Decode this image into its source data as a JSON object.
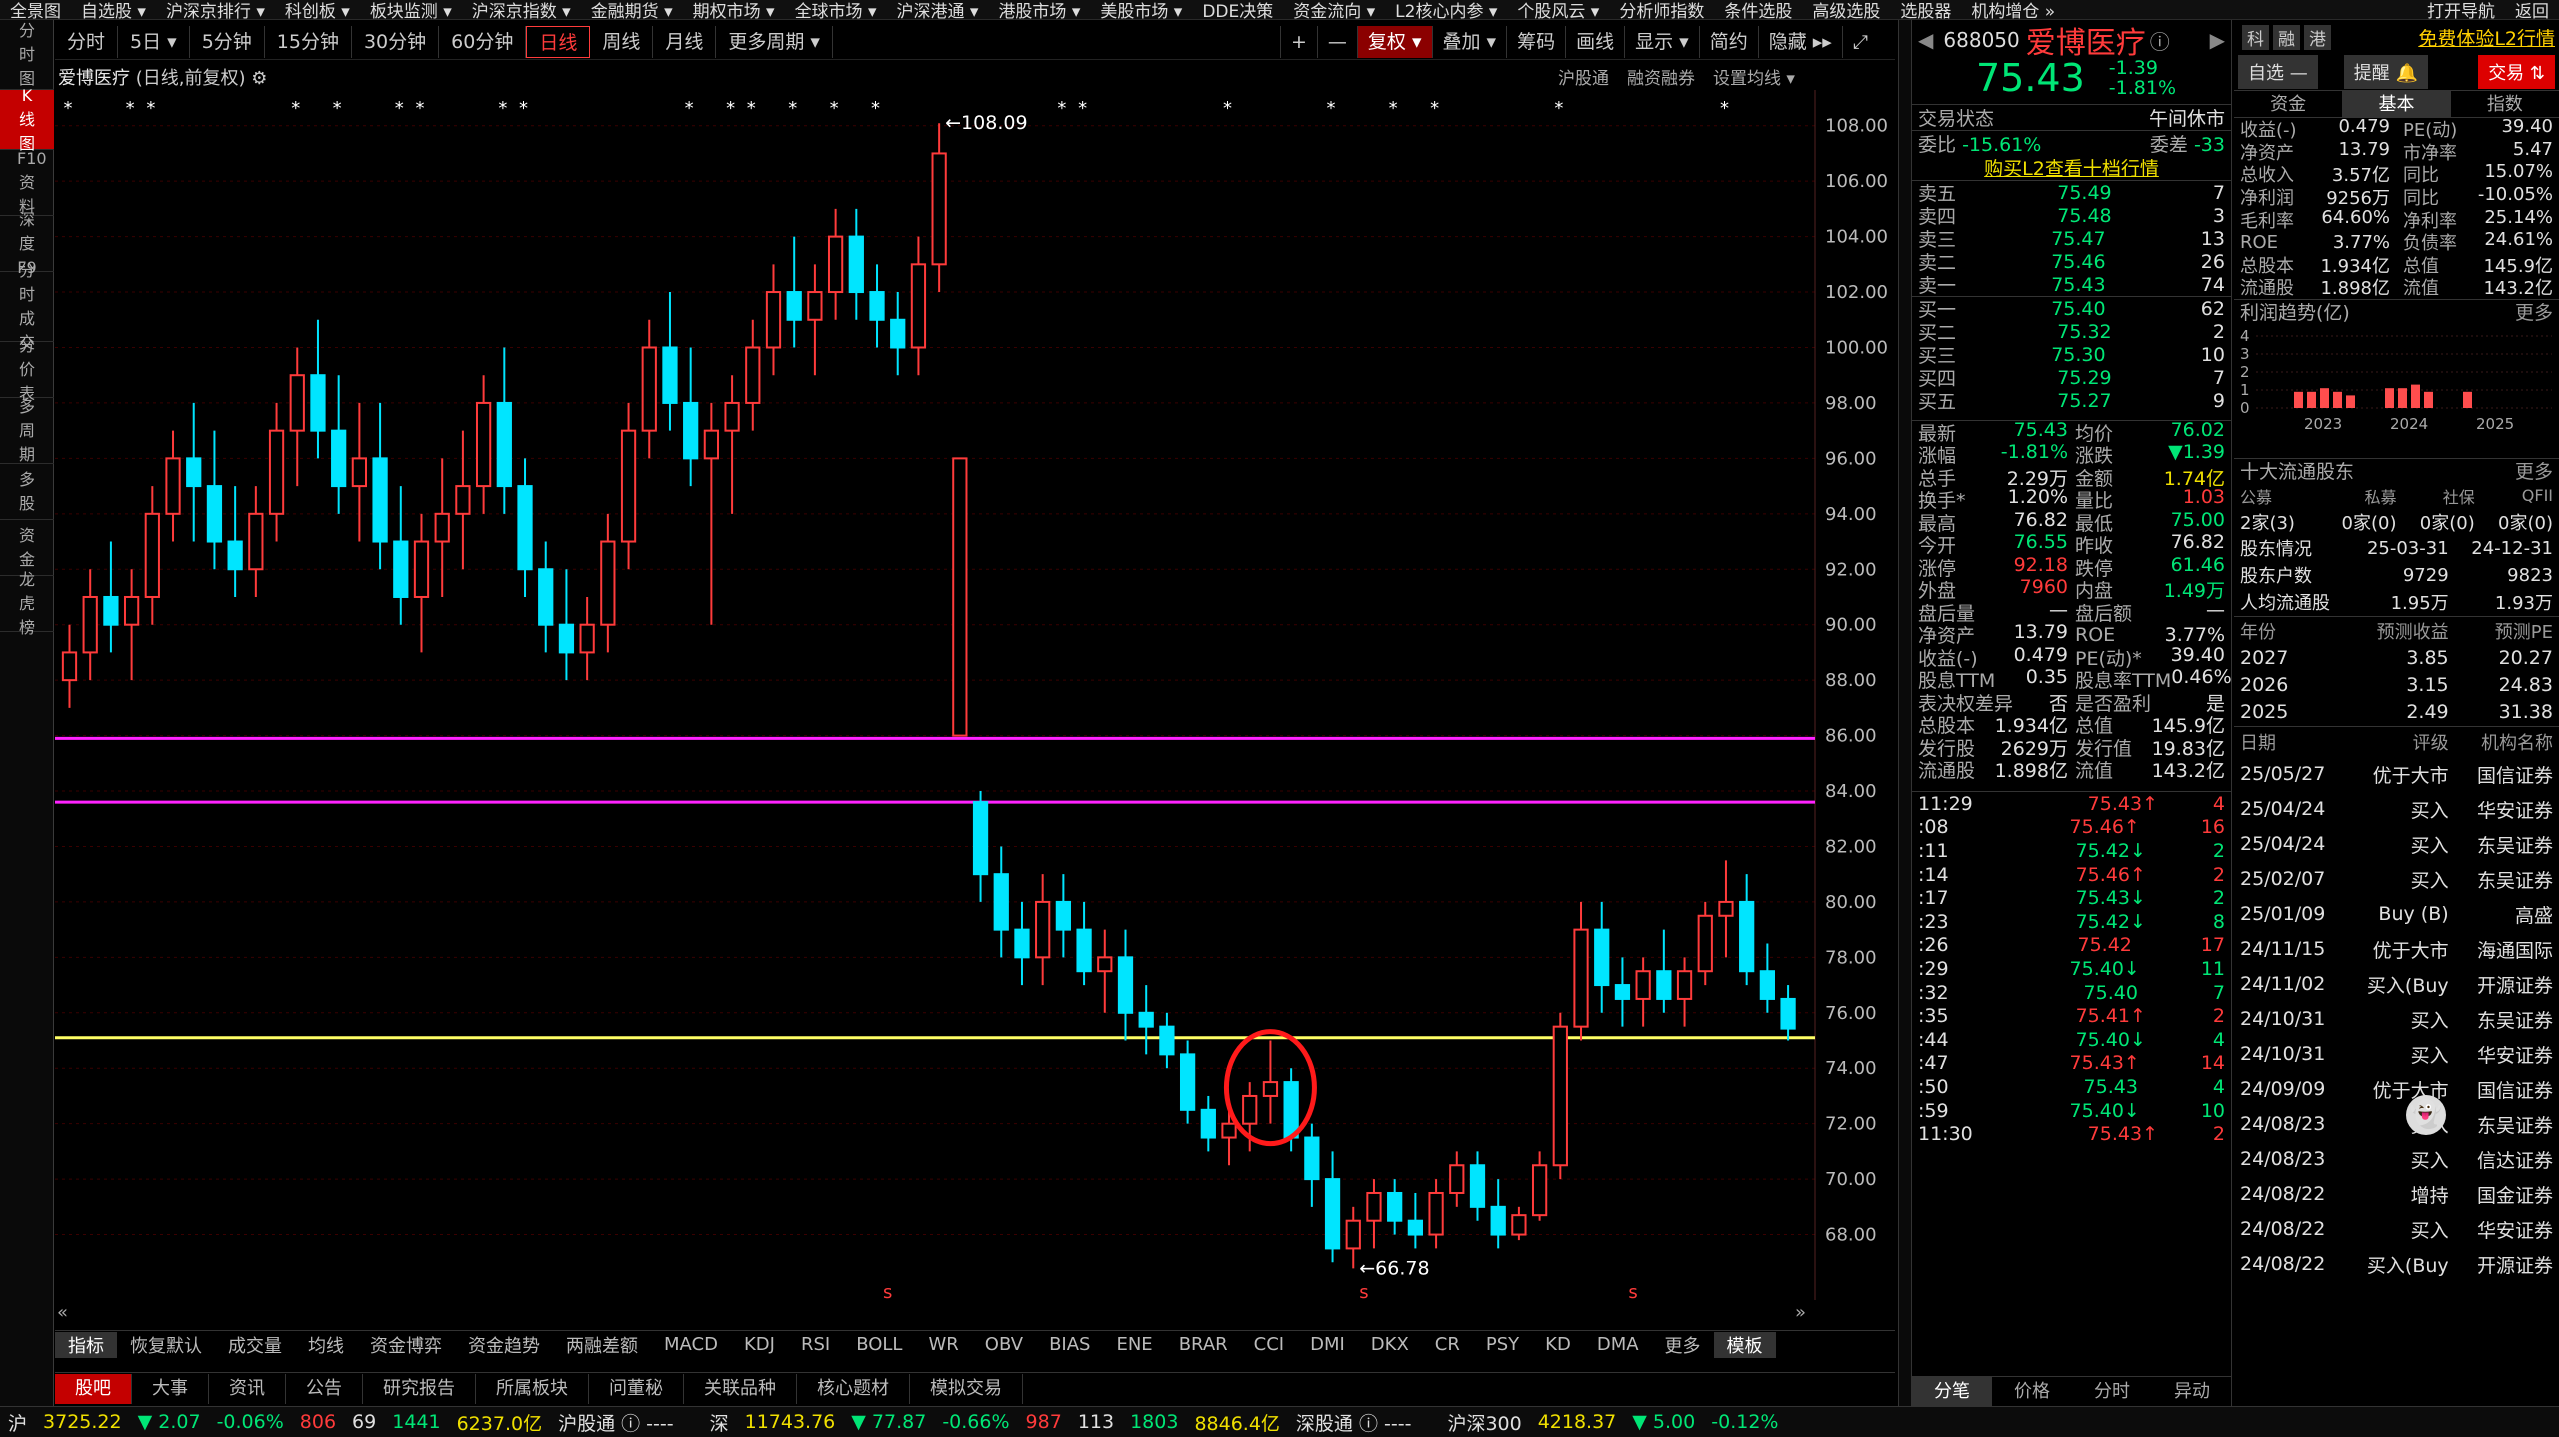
{
  "menu": [
    "全景图",
    "自选股 ▾",
    "沪深京排行 ▾",
    "科创板 ▾",
    "板块监测 ▾",
    "沪深京指数 ▾",
    "金融期货 ▾",
    "期权市场 ▾",
    "全球市场 ▾",
    "沪深港通 ▾",
    "港股市场 ▾",
    "美股市场 ▾",
    "DDE决策",
    "资金流向 ▾",
    "L2核心内参 ▾",
    "个股风云 ▾",
    "分析师指数",
    "条件选股",
    "高级选股",
    "选股器",
    "机构增仓 »"
  ],
  "menu_right": [
    "打开导航",
    "返回"
  ],
  "leftnav": [
    {
      "t": "分时图",
      "a": false
    },
    {
      "t": "K线图",
      "a": true
    },
    {
      "t": "F10资料",
      "a": false
    },
    {
      "t": "深度F9",
      "a": false
    },
    {
      "t": "分时成交",
      "a": false
    },
    {
      "t": "分价表",
      "a": false
    },
    {
      "t": "多周期",
      "a": false
    },
    {
      "t": "多股",
      "a": false
    },
    {
      "t": "资金",
      "a": false
    },
    {
      "t": "龙虎榜",
      "a": false
    }
  ],
  "periods": [
    {
      "t": "分时",
      "a": false
    },
    {
      "t": "5日 ▾",
      "a": false
    },
    {
      "t": "5分钟",
      "a": false
    },
    {
      "t": "15分钟",
      "a": false
    },
    {
      "t": "30分钟",
      "a": false
    },
    {
      "t": "60分钟",
      "a": false
    },
    {
      "t": "日线",
      "a": true
    },
    {
      "t": "周线",
      "a": false
    },
    {
      "t": "月线",
      "a": false
    },
    {
      "t": "更多周期 ▾",
      "a": false
    }
  ],
  "tools": [
    {
      "t": "+",
      "c": ""
    },
    {
      "t": "—",
      "c": ""
    },
    {
      "t": "复权 ▾",
      "c": "red"
    },
    {
      "t": "叠加 ▾",
      "c": ""
    },
    {
      "t": "筹码",
      "c": ""
    },
    {
      "t": "画线",
      "c": ""
    },
    {
      "t": "显示 ▾",
      "c": ""
    },
    {
      "t": "简约",
      "c": ""
    },
    {
      "t": "隐藏 ▸▸",
      "c": ""
    },
    {
      "t": "⤢",
      "c": ""
    }
  ],
  "chart_header": {
    "name": "爱博医疗",
    "mode": "(日线,前复权)"
  },
  "chart_links": [
    "沪股通",
    "融资融券",
    "设置均线 ▾"
  ],
  "indicator_tabs": [
    "指标",
    "恢复默认",
    "成交量",
    "均线",
    "资金博弈",
    "资金趋势",
    "两融差额",
    "MACD",
    "KDJ",
    "RSI",
    "BOLL",
    "WR",
    "OBV",
    "BIAS",
    "ENE",
    "BRAR",
    "CCI",
    "DMI",
    "DKX",
    "CR",
    "PSY",
    "KD",
    "DMA",
    "更多",
    "模板"
  ],
  "main_tabs": [
    "股吧",
    "大事",
    "资讯",
    "公告",
    "研究报告",
    "所属板块",
    "问董秘",
    "关联品种",
    "核心题材",
    "模拟交易"
  ],
  "status": {
    "sh": "沪",
    "sh_val": "3725.22",
    "sh_chg": "▼ 2.07",
    "sh_pct": "-0.06%",
    "sh_up": "806",
    "sh_flat": "69",
    "sh_dn": "1441",
    "sh_amt": "6237.0亿",
    "hgt": "沪股通 ⓘ ----",
    "sz": "深",
    "sz_val": "11743.76",
    "sz_chg": "▼ 77.87",
    "sz_pct": "-0.66%",
    "sz_up": "987",
    "sz_flat": "113",
    "sz_dn": "1803",
    "sz_amt": "8846.4亿",
    "sgt": "深股通 ⓘ ----",
    "hs300": "沪深300",
    "hs300_val": "4218.37",
    "hs300_chg": "▼ 5.00",
    "hs300_pct": "-0.12%"
  },
  "quote": {
    "code": "688050",
    "name": "爱博医疗",
    "price": "75.43",
    "chg": "-1.39",
    "pct": "-1.81%",
    "tags": [
      "科",
      "融",
      "港"
    ],
    "promo": "免费体验L2行情",
    "btn_watch": "自选 —",
    "btn_alert": "提醒 🔔",
    "btn_trade": "交易 ⇅",
    "trade_status_label": "交易状态",
    "trade_status": "午间休市",
    "weibi_label": "委比",
    "weibi": "-15.61%",
    "weicha_label": "委差",
    "weicha": "-33",
    "l2": "购买L2查看十档行情"
  },
  "asks": [
    {
      "l": "卖五",
      "p": "75.49",
      "v": "7"
    },
    {
      "l": "卖四",
      "p": "75.48",
      "v": "3"
    },
    {
      "l": "卖三",
      "p": "75.47",
      "v": "13"
    },
    {
      "l": "卖二",
      "p": "75.46",
      "v": "26"
    },
    {
      "l": "卖一",
      "p": "75.43",
      "v": "74"
    }
  ],
  "bids": [
    {
      "l": "买一",
      "p": "75.40",
      "v": "62"
    },
    {
      "l": "买二",
      "p": "75.32",
      "v": "2"
    },
    {
      "l": "买三",
      "p": "75.30",
      "v": "10"
    },
    {
      "l": "买四",
      "p": "75.29",
      "v": "7"
    },
    {
      "l": "买五",
      "p": "75.27",
      "v": "9"
    }
  ],
  "stats": [
    {
      "l1": "最新",
      "v1": "75.43",
      "c1": "g",
      "l2": "均价",
      "v2": "76.02",
      "c2": "g"
    },
    {
      "l1": "涨幅",
      "v1": "-1.81%",
      "c1": "g",
      "l2": "涨跌",
      "v2": "▼1.39",
      "c2": "g"
    },
    {
      "l1": "总手",
      "v1": "2.29万",
      "c1": "w",
      "l2": "金额",
      "v2": "1.74亿",
      "c2": "y"
    },
    {
      "l1": "换手*",
      "v1": "1.20%",
      "c1": "w",
      "l2": "量比",
      "v2": "1.03",
      "c2": "r"
    },
    {
      "l1": "最高",
      "v1": "76.82",
      "c1": "w",
      "l2": "最低",
      "v2": "75.00",
      "c2": "g"
    },
    {
      "l1": "今开",
      "v1": "76.55",
      "c1": "g",
      "l2": "昨收",
      "v2": "76.82",
      "c2": "w"
    },
    {
      "l1": "涨停",
      "v1": "92.18",
      "c1": "r",
      "l2": "跌停",
      "v2": "61.46",
      "c2": "g"
    },
    {
      "l1": "外盘",
      "v1": "7960",
      "c1": "r",
      "l2": "内盘",
      "v2": "1.49万",
      "c2": "g"
    },
    {
      "l1": "盘后量",
      "v1": "—",
      "c1": "w",
      "l2": "盘后额",
      "v2": "—",
      "c2": "w"
    },
    {
      "l1": "净资产",
      "v1": "13.79",
      "c1": "w",
      "l2": "ROE",
      "v2": "3.77%",
      "c2": "w"
    },
    {
      "l1": "收益(-)",
      "v1": "0.479",
      "c1": "w",
      "l2": "PE(动)*",
      "v2": "39.40",
      "c2": "w"
    },
    {
      "l1": "股息TTM",
      "v1": "0.35",
      "c1": "w",
      "l2": "股息率TTM",
      "v2": "0.46%",
      "c2": "w"
    },
    {
      "l1": "表决权差异",
      "v1": "否",
      "c1": "w",
      "l2": "是否盈利",
      "v2": "是",
      "c2": "w"
    },
    {
      "l1": "总股本",
      "v1": "1.934亿",
      "c1": "w",
      "l2": "总值",
      "v2": "145.9亿",
      "c2": "w"
    },
    {
      "l1": "发行股",
      "v1": "2629万",
      "c1": "w",
      "l2": "发行值",
      "v2": "19.83亿",
      "c2": "w"
    },
    {
      "l1": "流通股",
      "v1": "1.898亿",
      "c1": "w",
      "l2": "流值",
      "v2": "143.2亿",
      "c2": "w"
    }
  ],
  "ticks": [
    {
      "t": "11:29",
      "p": "75.43",
      "d": "↑",
      "v": "4",
      "c": "r"
    },
    {
      "t": ":08",
      "p": "75.46",
      "d": "↑",
      "v": "16",
      "c": "r"
    },
    {
      "t": ":11",
      "p": "75.42",
      "d": "↓",
      "v": "2",
      "c": "g"
    },
    {
      "t": ":14",
      "p": "75.46",
      "d": "↑",
      "v": "2",
      "c": "r"
    },
    {
      "t": ":17",
      "p": "75.43",
      "d": "↓",
      "v": "2",
      "c": "g"
    },
    {
      "t": ":23",
      "p": "75.42",
      "d": "↓",
      "v": "8",
      "c": "g"
    },
    {
      "t": ":26",
      "p": "75.42",
      "d": "",
      "v": "17",
      "c": "r"
    },
    {
      "t": ":29",
      "p": "75.40",
      "d": "↓",
      "v": "11",
      "c": "g"
    },
    {
      "t": ":32",
      "p": "75.40",
      "d": "",
      "v": "7",
      "c": "g"
    },
    {
      "t": ":35",
      "p": "75.41",
      "d": "↑",
      "v": "2",
      "c": "r"
    },
    {
      "t": ":44",
      "p": "75.40",
      "d": "↓",
      "v": "4",
      "c": "g"
    },
    {
      "t": ":47",
      "p": "75.43",
      "d": "↑",
      "v": "14",
      "c": "r"
    },
    {
      "t": ":50",
      "p": "75.43",
      "d": "",
      "v": "4",
      "c": "g"
    },
    {
      "t": ":59",
      "p": "75.40",
      "d": "↓",
      "v": "10",
      "c": "g"
    },
    {
      "t": "11:30",
      "p": "75.43",
      "d": "↑",
      "v": "2",
      "c": "r"
    }
  ],
  "rp_tabs": [
    "分笔",
    "价格",
    "分时",
    "异动"
  ],
  "fin_tabs": [
    "资金",
    "基本",
    "指数"
  ],
  "fin": [
    {
      "l1": "收益(-)",
      "v1": "0.479",
      "l2": "PE(动)",
      "v2": "39.40"
    },
    {
      "l1": "净资产",
      "v1": "13.79",
      "l2": "市净率",
      "v2": "5.47"
    },
    {
      "l1": "总收入",
      "v1": "3.57亿",
      "l2": "同比",
      "v2": "15.07%"
    },
    {
      "l1": "净利润",
      "v1": "9256万",
      "l2": "同比",
      "v2": "-10.05%"
    },
    {
      "l1": "毛利率",
      "v1": "64.60%",
      "l2": "净利率",
      "v2": "25.14%"
    },
    {
      "l1": "ROE",
      "v1": "3.77%",
      "l2": "负债率",
      "v2": "24.61%"
    },
    {
      "l1": "总股本",
      "v1": "1.934亿",
      "l2": "总值",
      "v2": "145.9亿"
    },
    {
      "l1": "流通股",
      "v1": "1.898亿",
      "l2": "流值",
      "v2": "143.2亿"
    }
  ],
  "profit_title": "利润趋势(亿)",
  "more": "更多",
  "profit_yticks": [
    "4",
    "3",
    "2",
    "1",
    "0"
  ],
  "profit_years": [
    "2023",
    "2024",
    "2025"
  ],
  "profit_bars": [
    0.9,
    0.9,
    1.1,
    0.9,
    0.7,
    0,
    0,
    1.1,
    1.1,
    1.3,
    0.9,
    0,
    0,
    0.9
  ],
  "holders_title": "十大流通股东",
  "holders_head": [
    "公募",
    "私募",
    "社保",
    "QFII"
  ],
  "holders_vals": [
    "2家(3)",
    "0家(0)",
    "0家(0)",
    "0家(0)"
  ],
  "holder_rows": [
    {
      "l": "股东情况",
      "a": "25-03-31",
      "b": "24-12-31"
    },
    {
      "l": "股东户数",
      "a": "9729",
      "b": "9823"
    },
    {
      "l": "人均流通股",
      "a": "1.95万",
      "b": "1.93万"
    }
  ],
  "forecast_head": [
    "年份",
    "预测收益",
    "预测PE"
  ],
  "forecast": [
    {
      "y": "2027",
      "e": "3.85",
      "pe": "20.27"
    },
    {
      "y": "2026",
      "e": "3.15",
      "pe": "24.83"
    },
    {
      "y": "2025",
      "e": "2.49",
      "pe": "31.38"
    }
  ],
  "ratings_head": [
    "日期",
    "评级",
    "机构名称"
  ],
  "ratings": [
    {
      "d": "25/05/27",
      "r": "优于大市",
      "o": "国信证券"
    },
    {
      "d": "25/04/24",
      "r": "买入",
      "o": "华安证券"
    },
    {
      "d": "25/04/24",
      "r": "买入",
      "o": "东吴证券"
    },
    {
      "d": "25/02/07",
      "r": "买入",
      "o": "东吴证券"
    },
    {
      "d": "25/01/09",
      "r": "Buy (B)",
      "o": "高盛"
    },
    {
      "d": "24/11/15",
      "r": "优于大市",
      "o": "海通国际"
    },
    {
      "d": "24/11/02",
      "r": "买入(Buy",
      "o": "开源证券"
    },
    {
      "d": "24/10/31",
      "r": "买入",
      "o": "东吴证券"
    },
    {
      "d": "24/10/31",
      "r": "买入",
      "o": "华安证券"
    },
    {
      "d": "24/09/09",
      "r": "优于大市",
      "o": "国信证券"
    },
    {
      "d": "24/08/23",
      "r": "买入",
      "o": "东吴证券"
    },
    {
      "d": "24/08/23",
      "r": "买入",
      "o": "信达证券"
    },
    {
      "d": "24/08/22",
      "r": "增持",
      "o": "国金证券"
    },
    {
      "d": "24/08/22",
      "r": "买入",
      "o": "华安证券"
    },
    {
      "d": "24/08/22",
      "r": "买入(Buy",
      "o": "开源证券"
    }
  ],
  "colors": {
    "up": "#ff3b3b",
    "down": "#00e5ff",
    "hline_magenta": "#ff22ff",
    "hline_yellow": "#ffff66",
    "grid": "#3a0000",
    "bg": "#000000"
  },
  "chart_data": {
    "type": "candlestick",
    "ylim": [
      66,
      109
    ],
    "yticks": [
      "108.00",
      "106.00",
      "104.00",
      "102.00",
      "100.00",
      "98.00",
      "96.00",
      "94.00",
      "92.00",
      "90.00",
      "88.00",
      "86.00",
      "84.00",
      "82.00",
      "80.00",
      "78.00",
      "76.00",
      "74.00",
      "72.00",
      "70.00",
      "68.00"
    ],
    "hlines": [
      {
        "y": 85.9,
        "color": "magenta"
      },
      {
        "y": 83.6,
        "color": "magenta"
      },
      {
        "y": 75.1,
        "color": "yellow"
      }
    ],
    "annotations": [
      {
        "label": "108.09",
        "i": 42
      },
      {
        "label": "66.78",
        "i": 62
      }
    ],
    "candles": [
      [
        88,
        90,
        87,
        89
      ],
      [
        89,
        92,
        88,
        91
      ],
      [
        91,
        93,
        89,
        90
      ],
      [
        90,
        92,
        88,
        91
      ],
      [
        91,
        95,
        90,
        94
      ],
      [
        94,
        97,
        93,
        96
      ],
      [
        96,
        98,
        93,
        95
      ],
      [
        95,
        97,
        92,
        93
      ],
      [
        93,
        95,
        91,
        92
      ],
      [
        92,
        95,
        91,
        94
      ],
      [
        94,
        98,
        93,
        97
      ],
      [
        97,
        100,
        95,
        99
      ],
      [
        99,
        101,
        96,
        97
      ],
      [
        97,
        99,
        94,
        95
      ],
      [
        95,
        98,
        93,
        96
      ],
      [
        96,
        98,
        92,
        93
      ],
      [
        93,
        95,
        90,
        91
      ],
      [
        91,
        94,
        89,
        93
      ],
      [
        93,
        96,
        91,
        94
      ],
      [
        94,
        97,
        92,
        95
      ],
      [
        95,
        99,
        94,
        98
      ],
      [
        98,
        100,
        94,
        95
      ],
      [
        95,
        96,
        91,
        92
      ],
      [
        92,
        93,
        89,
        90
      ],
      [
        90,
        92,
        88,
        89
      ],
      [
        89,
        91,
        88,
        90
      ],
      [
        90,
        94,
        89,
        93
      ],
      [
        93,
        98,
        92,
        97
      ],
      [
        97,
        101,
        96,
        100
      ],
      [
        100,
        102,
        97,
        98
      ],
      [
        98,
        100,
        95,
        96
      ],
      [
        96,
        98,
        90,
        97
      ],
      [
        97,
        99,
        94,
        98
      ],
      [
        98,
        101,
        97,
        100
      ],
      [
        100,
        103,
        99,
        102
      ],
      [
        102,
        104,
        100,
        101
      ],
      [
        101,
        103,
        99,
        102
      ],
      [
        102,
        105,
        101,
        104
      ],
      [
        104,
        105,
        101,
        102
      ],
      [
        102,
        103,
        100,
        101
      ],
      [
        101,
        102,
        99,
        100
      ],
      [
        100,
        104,
        99,
        103
      ],
      [
        103,
        108.09,
        102,
        107
      ],
      [
        86,
        96,
        86,
        96
      ],
      [
        83.6,
        84,
        80,
        81
      ],
      [
        81,
        82,
        78,
        79
      ],
      [
        79,
        80,
        77,
        78
      ],
      [
        78,
        81,
        77,
        80
      ],
      [
        80,
        81,
        78,
        79
      ],
      [
        79,
        80,
        77,
        77.5
      ],
      [
        77.5,
        79,
        76,
        78
      ],
      [
        78,
        79,
        75,
        76
      ],
      [
        76,
        77,
        74.5,
        75.5
      ],
      [
        75.5,
        76,
        74,
        74.5
      ],
      [
        74.5,
        75,
        72,
        72.5
      ],
      [
        72.5,
        73,
        71,
        71.5
      ],
      [
        71.5,
        72.5,
        70.5,
        72
      ],
      [
        72,
        73.5,
        71,
        73
      ],
      [
        73,
        75,
        72,
        73.5
      ],
      [
        73.5,
        74,
        71,
        71.5
      ],
      [
        71.5,
        72,
        69,
        70
      ],
      [
        70,
        71,
        67,
        67.5
      ],
      [
        67.5,
        69,
        66.78,
        68.5
      ],
      [
        68.5,
        70,
        67.5,
        69.5
      ],
      [
        69.5,
        70,
        68,
        68.5
      ],
      [
        68.5,
        69.5,
        67.5,
        68
      ],
      [
        68,
        70,
        67.5,
        69.5
      ],
      [
        69.5,
        71,
        69,
        70.5
      ],
      [
        70.5,
        71,
        68.5,
        69
      ],
      [
        69,
        70,
        67.5,
        68
      ],
      [
        68,
        69,
        67.8,
        68.7
      ],
      [
        68.7,
        71,
        68.5,
        70.5
      ],
      [
        70.5,
        76,
        70,
        75.5
      ],
      [
        75.5,
        80,
        75,
        79
      ],
      [
        79,
        80,
        76,
        77
      ],
      [
        77,
        78,
        75.5,
        76.5
      ],
      [
        76.5,
        78,
        75.5,
        77.5
      ],
      [
        77.5,
        79,
        76,
        76.5
      ],
      [
        76.5,
        78,
        75.5,
        77.5
      ],
      [
        77.5,
        80,
        77,
        79.5
      ],
      [
        79.5,
        81.5,
        78,
        80
      ],
      [
        80,
        81,
        77,
        77.5
      ],
      [
        77.5,
        78.5,
        76,
        76.5
      ],
      [
        76.5,
        77,
        75,
        75.43
      ]
    ]
  }
}
